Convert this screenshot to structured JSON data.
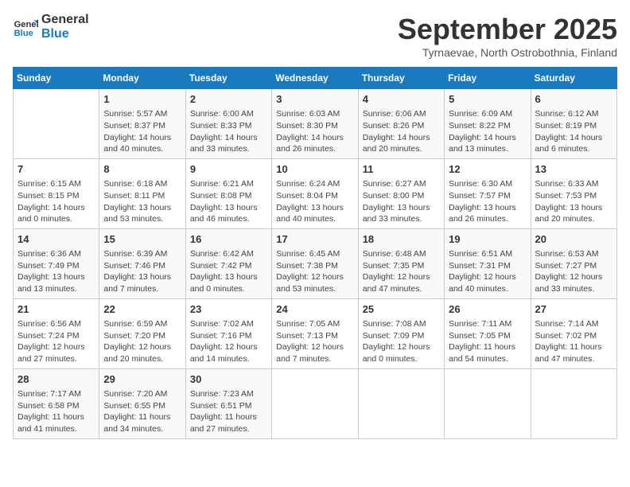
{
  "header": {
    "logo_line1": "General",
    "logo_line2": "Blue",
    "month_title": "September 2025",
    "subtitle": "Tyrnaevae, North Ostrobothnia, Finland"
  },
  "weekdays": [
    "Sunday",
    "Monday",
    "Tuesday",
    "Wednesday",
    "Thursday",
    "Friday",
    "Saturday"
  ],
  "weeks": [
    [
      {
        "day": "",
        "data": ""
      },
      {
        "day": "1",
        "data": "Sunrise: 5:57 AM\nSunset: 8:37 PM\nDaylight: 14 hours\nand 40 minutes."
      },
      {
        "day": "2",
        "data": "Sunrise: 6:00 AM\nSunset: 8:33 PM\nDaylight: 14 hours\nand 33 minutes."
      },
      {
        "day": "3",
        "data": "Sunrise: 6:03 AM\nSunset: 8:30 PM\nDaylight: 14 hours\nand 26 minutes."
      },
      {
        "day": "4",
        "data": "Sunrise: 6:06 AM\nSunset: 8:26 PM\nDaylight: 14 hours\nand 20 minutes."
      },
      {
        "day": "5",
        "data": "Sunrise: 6:09 AM\nSunset: 8:22 PM\nDaylight: 14 hours\nand 13 minutes."
      },
      {
        "day": "6",
        "data": "Sunrise: 6:12 AM\nSunset: 8:19 PM\nDaylight: 14 hours\nand 6 minutes."
      }
    ],
    [
      {
        "day": "7",
        "data": "Sunrise: 6:15 AM\nSunset: 8:15 PM\nDaylight: 14 hours\nand 0 minutes."
      },
      {
        "day": "8",
        "data": "Sunrise: 6:18 AM\nSunset: 8:11 PM\nDaylight: 13 hours\nand 53 minutes."
      },
      {
        "day": "9",
        "data": "Sunrise: 6:21 AM\nSunset: 8:08 PM\nDaylight: 13 hours\nand 46 minutes."
      },
      {
        "day": "10",
        "data": "Sunrise: 6:24 AM\nSunset: 8:04 PM\nDaylight: 13 hours\nand 40 minutes."
      },
      {
        "day": "11",
        "data": "Sunrise: 6:27 AM\nSunset: 8:00 PM\nDaylight: 13 hours\nand 33 minutes."
      },
      {
        "day": "12",
        "data": "Sunrise: 6:30 AM\nSunset: 7:57 PM\nDaylight: 13 hours\nand 26 minutes."
      },
      {
        "day": "13",
        "data": "Sunrise: 6:33 AM\nSunset: 7:53 PM\nDaylight: 13 hours\nand 20 minutes."
      }
    ],
    [
      {
        "day": "14",
        "data": "Sunrise: 6:36 AM\nSunset: 7:49 PM\nDaylight: 13 hours\nand 13 minutes."
      },
      {
        "day": "15",
        "data": "Sunrise: 6:39 AM\nSunset: 7:46 PM\nDaylight: 13 hours\nand 7 minutes."
      },
      {
        "day": "16",
        "data": "Sunrise: 6:42 AM\nSunset: 7:42 PM\nDaylight: 13 hours\nand 0 minutes."
      },
      {
        "day": "17",
        "data": "Sunrise: 6:45 AM\nSunset: 7:38 PM\nDaylight: 12 hours\nand 53 minutes."
      },
      {
        "day": "18",
        "data": "Sunrise: 6:48 AM\nSunset: 7:35 PM\nDaylight: 12 hours\nand 47 minutes."
      },
      {
        "day": "19",
        "data": "Sunrise: 6:51 AM\nSunset: 7:31 PM\nDaylight: 12 hours\nand 40 minutes."
      },
      {
        "day": "20",
        "data": "Sunrise: 6:53 AM\nSunset: 7:27 PM\nDaylight: 12 hours\nand 33 minutes."
      }
    ],
    [
      {
        "day": "21",
        "data": "Sunrise: 6:56 AM\nSunset: 7:24 PM\nDaylight: 12 hours\nand 27 minutes."
      },
      {
        "day": "22",
        "data": "Sunrise: 6:59 AM\nSunset: 7:20 PM\nDaylight: 12 hours\nand 20 minutes."
      },
      {
        "day": "23",
        "data": "Sunrise: 7:02 AM\nSunset: 7:16 PM\nDaylight: 12 hours\nand 14 minutes."
      },
      {
        "day": "24",
        "data": "Sunrise: 7:05 AM\nSunset: 7:13 PM\nDaylight: 12 hours\nand 7 minutes."
      },
      {
        "day": "25",
        "data": "Sunrise: 7:08 AM\nSunset: 7:09 PM\nDaylight: 12 hours\nand 0 minutes."
      },
      {
        "day": "26",
        "data": "Sunrise: 7:11 AM\nSunset: 7:05 PM\nDaylight: 11 hours\nand 54 minutes."
      },
      {
        "day": "27",
        "data": "Sunrise: 7:14 AM\nSunset: 7:02 PM\nDaylight: 11 hours\nand 47 minutes."
      }
    ],
    [
      {
        "day": "28",
        "data": "Sunrise: 7:17 AM\nSunset: 6:58 PM\nDaylight: 11 hours\nand 41 minutes."
      },
      {
        "day": "29",
        "data": "Sunrise: 7:20 AM\nSunset: 6:55 PM\nDaylight: 11 hours\nand 34 minutes."
      },
      {
        "day": "30",
        "data": "Sunrise: 7:23 AM\nSunset: 6:51 PM\nDaylight: 11 hours\nand 27 minutes."
      },
      {
        "day": "",
        "data": ""
      },
      {
        "day": "",
        "data": ""
      },
      {
        "day": "",
        "data": ""
      },
      {
        "day": "",
        "data": ""
      }
    ]
  ]
}
